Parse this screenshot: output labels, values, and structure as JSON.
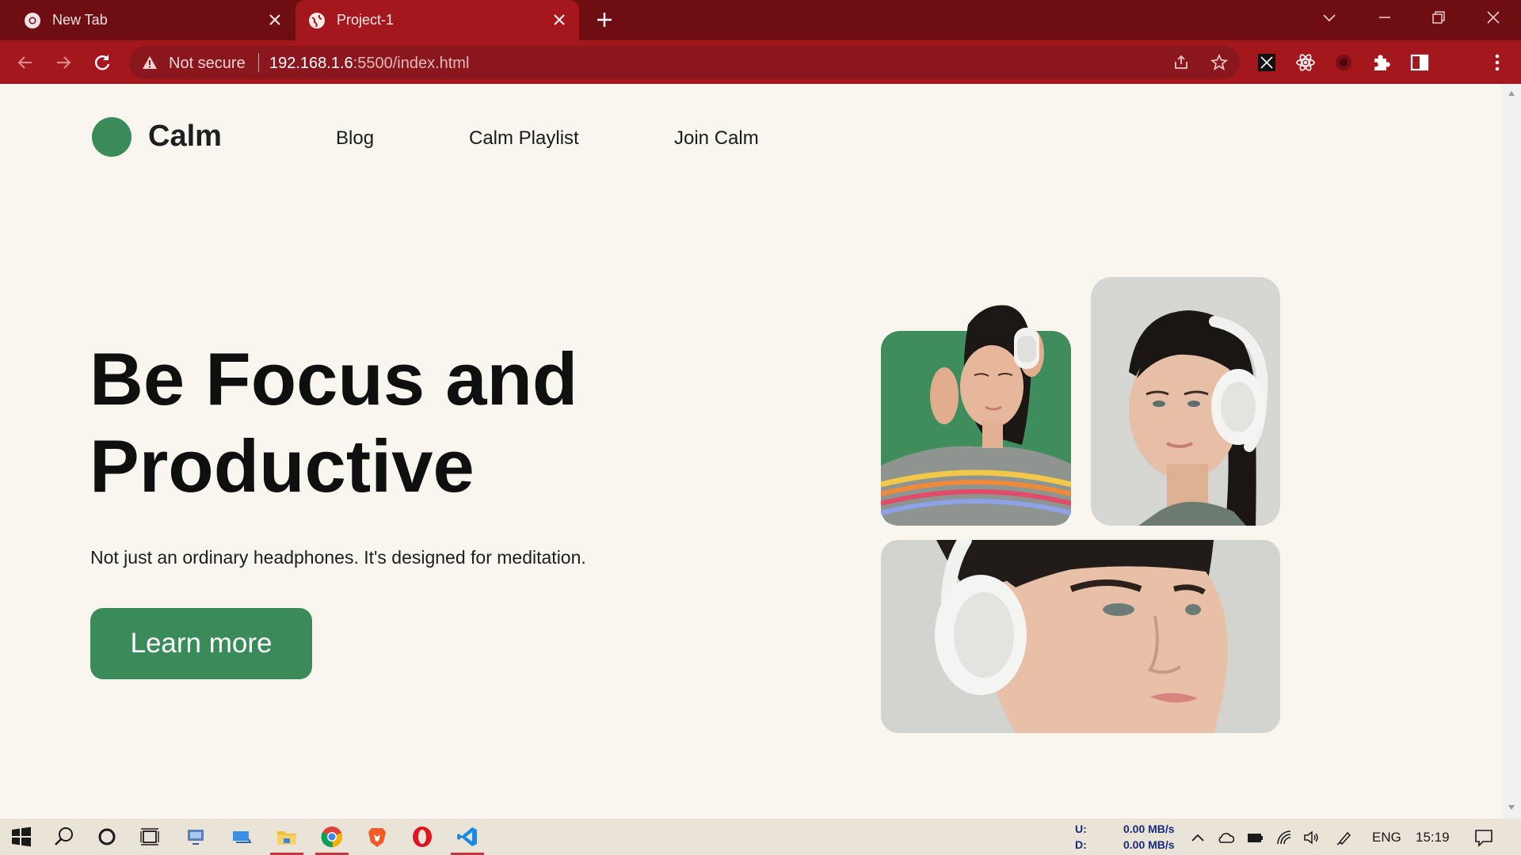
{
  "browser": {
    "tabs": [
      {
        "title": "New Tab",
        "active": false
      },
      {
        "title": "Project-1",
        "active": true
      }
    ],
    "security_label": "Not secure",
    "url_host": "192.168.1.6",
    "url_rest": ":5500/index.html",
    "accent_color": "#a3171d",
    "frame_color": "#6e0e13"
  },
  "site": {
    "logo_text": "Calm",
    "nav": [
      "Blog",
      "Calm Playlist",
      "Join Calm"
    ],
    "hero": {
      "title_line1": "Be Focus and",
      "title_line2": "Productive",
      "subtitle": "Not just an ordinary headphones. It's designed for meditation.",
      "cta_label": "Learn more"
    },
    "brand_color": "#3b8a5a",
    "background_color": "#f9f5ef"
  },
  "taskbar": {
    "net_up_label": "U:",
    "net_down_label": "D:",
    "net_up_value": "0.00 MB/s",
    "net_down_value": "0.00 MB/s",
    "language": "ENG",
    "time": "15:19",
    "apps": [
      "windows-start",
      "search",
      "cortana",
      "task-view",
      "app-1",
      "app-2",
      "file-explorer",
      "chrome",
      "brave",
      "opera",
      "vscode"
    ]
  }
}
